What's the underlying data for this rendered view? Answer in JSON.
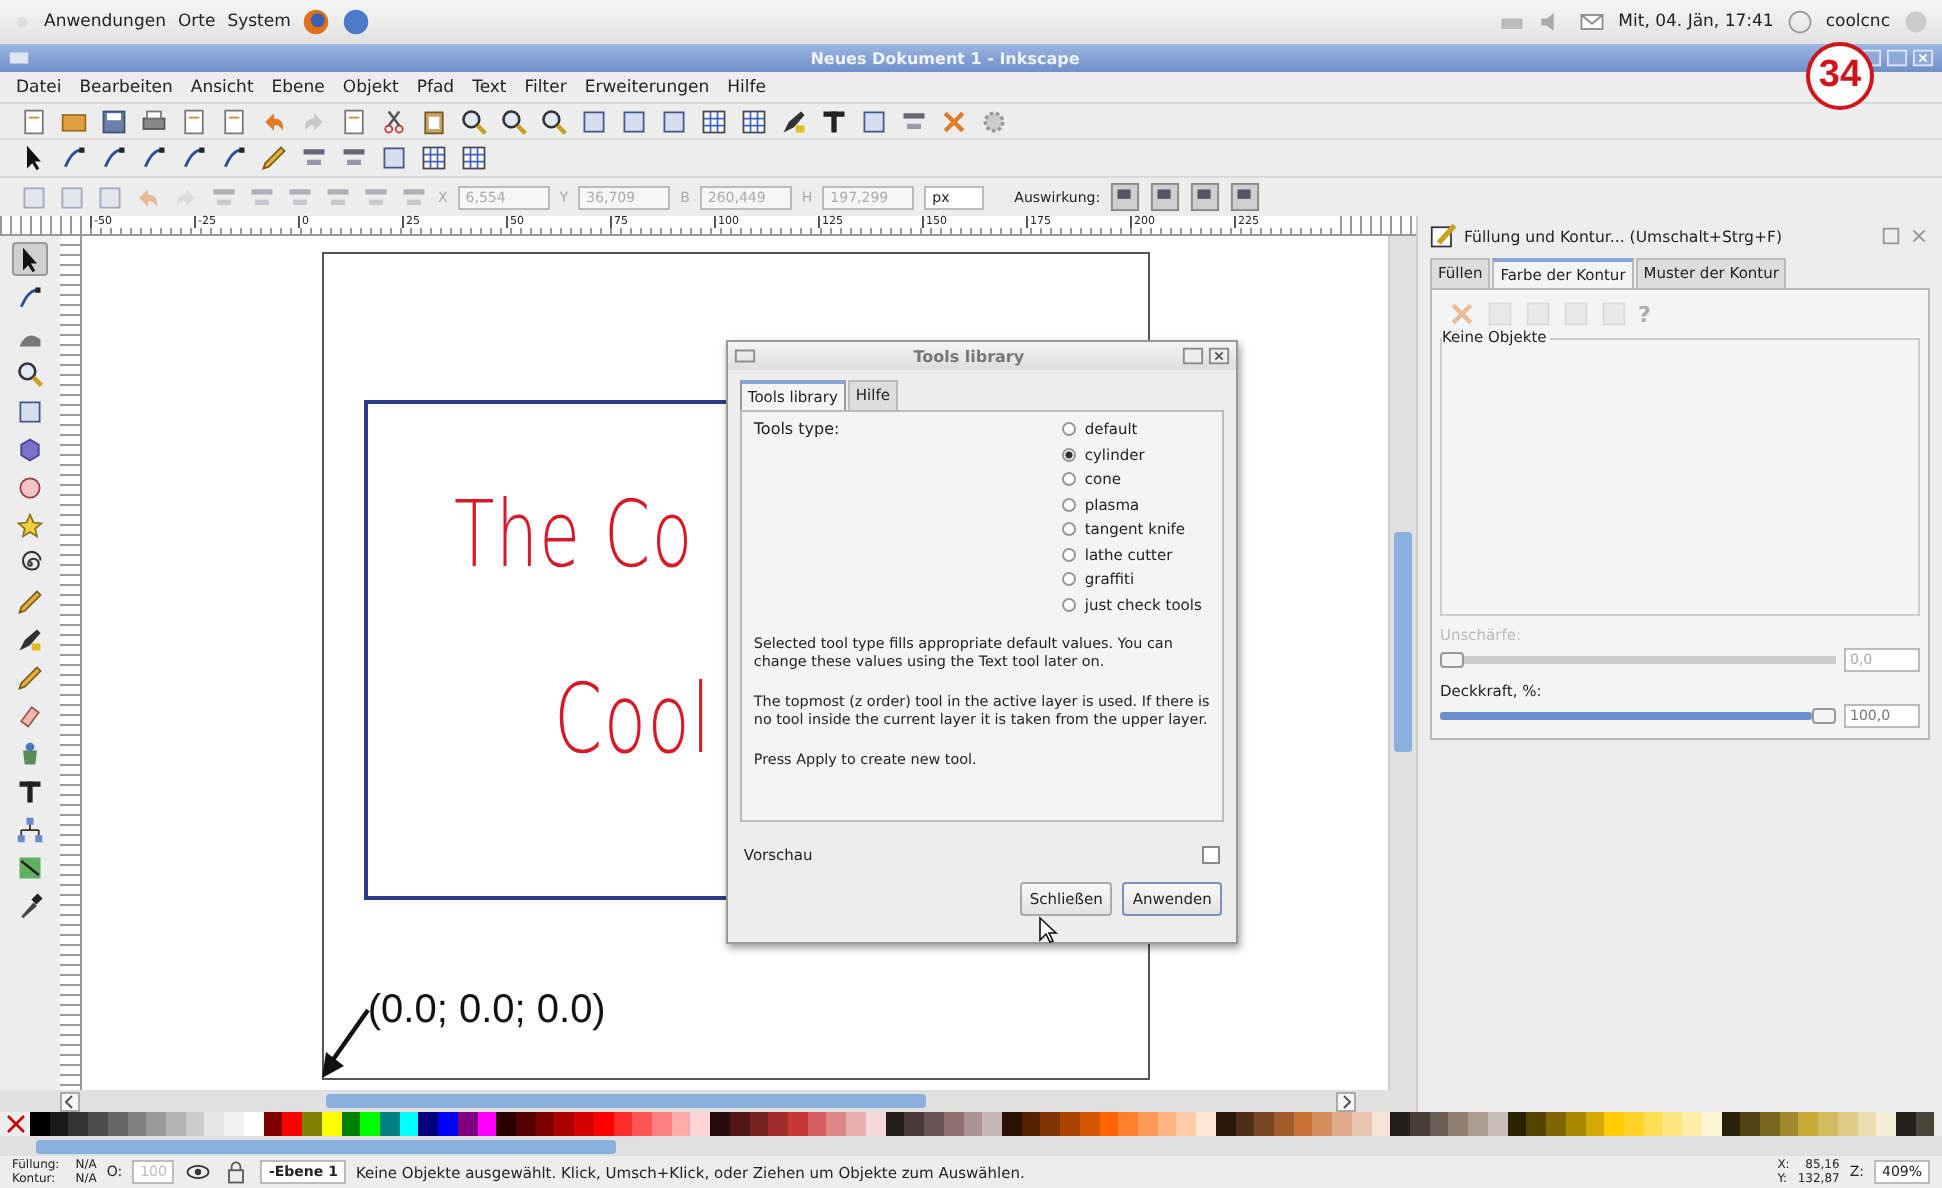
{
  "top_panel": {
    "menus": [
      "Anwendungen",
      "Orte",
      "System"
    ],
    "clock": "Mit, 04. Jän, 17:41",
    "user": "coolcnc"
  },
  "window": {
    "title": "Neues Dokument 1 - Inkscape"
  },
  "page_badge": "34",
  "menubar": [
    "Datei",
    "Bearbeiten",
    "Ansicht",
    "Ebene",
    "Objekt",
    "Pfad",
    "Text",
    "Filter",
    "Erweiterungen",
    "Hilfe"
  ],
  "toolbar_fields": [
    {
      "label": "X",
      "value": "6,554"
    },
    {
      "label": "Y",
      "value": "36,709"
    },
    {
      "label": "B",
      "value": "260,449"
    },
    {
      "label": "H",
      "value": "197,299"
    }
  ],
  "unit": "px",
  "effect_label": "Auswirkung:",
  "ruler_labels": [
    "-50",
    "-25",
    "0",
    "25",
    "50",
    "75",
    "100",
    "125",
    "150",
    "175",
    "200",
    "225"
  ],
  "toolbox": [
    {
      "selected": true
    },
    {
      "selected": false
    },
    {
      "selected": false
    },
    {
      "selected": false
    },
    {
      "selected": false
    },
    {
      "selected": false
    },
    {
      "selected": false
    },
    {
      "selected": false
    },
    {
      "selected": false
    },
    {
      "selected": false
    },
    {
      "selected": false
    },
    {
      "selected": false
    },
    {
      "selected": false
    },
    {
      "selected": false
    },
    {
      "selected": false
    },
    {
      "selected": false
    },
    {
      "selected": false
    },
    {
      "selected": false
    }
  ],
  "canvas": {
    "title_lines": [
      "The Co",
      "Cool"
    ],
    "coordinate_label": "(0.0; 0.0; 0.0)"
  },
  "dialog": {
    "title": "Tools library",
    "tabs": [
      {
        "label": "Tools library",
        "selected": true
      },
      {
        "label": "Hilfe",
        "selected": false
      }
    ],
    "type_label": "Tools type:",
    "options": [
      {
        "label": "default",
        "selected": false
      },
      {
        "label": "cylinder",
        "selected": true
      },
      {
        "label": "cone",
        "selected": false
      },
      {
        "label": "plasma",
        "selected": false
      },
      {
        "label": "tangent knife",
        "selected": false
      },
      {
        "label": "lathe cutter",
        "selected": false
      },
      {
        "label": "graffiti",
        "selected": false
      },
      {
        "label": "just check tools",
        "selected": false
      }
    ],
    "paragraphs": [
      "Selected tool type fills appropriate default values. You can change these values using the Text tool later on.",
      "The topmost (z order) tool in the active layer is used. If there is no tool inside the current layer it is taken from the upper layer.",
      "Press Apply to create new tool."
    ],
    "preview": {
      "label": "Vorschau",
      "checked": false
    },
    "buttons": [
      "Schließen",
      "Anwenden"
    ]
  },
  "fill_stroke": {
    "title": "Füllung und Kontur... (Umschalt+Strg+F)",
    "tabs": [
      {
        "label": "Füllen",
        "selected": false
      },
      {
        "label": "Farbe der Kontur",
        "selected": true
      },
      {
        "label": "Muster der Kontur",
        "selected": false
      }
    ],
    "unset_glyph": "?",
    "frame_label": "Keine Objekte",
    "sliders": [
      {
        "label": "Unschärfe:",
        "disabled": true,
        "level": 0,
        "value": "0,0"
      },
      {
        "label": "Deckkraft, %:",
        "disabled": false,
        "level": 1,
        "value": "100,0"
      }
    ]
  },
  "palette": [
    {
      "color": "#000000"
    },
    {
      "color": "#1a1a1a"
    },
    {
      "color": "#333333"
    },
    {
      "color": "#4d4d4d"
    },
    {
      "color": "#666666"
    },
    {
      "color": "#808080"
    },
    {
      "color": "#999999"
    },
    {
      "color": "#b3b3b3"
    },
    {
      "color": "#cccccc"
    },
    {
      "color": "#e6e6e6"
    },
    {
      "color": "#f2f2f2"
    },
    {
      "color": "#ffffff"
    },
    {
      "color": "#800000"
    },
    {
      "color": "#ff0000"
    },
    {
      "color": "#808000"
    },
    {
      "color": "#ffff00"
    },
    {
      "color": "#008000"
    },
    {
      "color": "#00ff00"
    },
    {
      "color": "#008080"
    },
    {
      "color": "#00ffff"
    },
    {
      "color": "#000080"
    },
    {
      "color": "#0000ff"
    },
    {
      "color": "#800080"
    },
    {
      "color": "#ff00ff"
    },
    {
      "color": "#2b0000"
    },
    {
      "color": "#550000"
    },
    {
      "color": "#800000"
    },
    {
      "color": "#aa0000"
    },
    {
      "color": "#d40000"
    },
    {
      "color": "#ff0000"
    },
    {
      "color": "#ff2a2a"
    },
    {
      "color": "#ff5555"
    },
    {
      "color": "#ff8080"
    },
    {
      "color": "#ffaaaa"
    },
    {
      "color": "#ffd5d5"
    },
    {
      "color": "#280b0b"
    },
    {
      "color": "#501616"
    },
    {
      "color": "#782121"
    },
    {
      "color": "#a02c2c"
    },
    {
      "color": "#c83737"
    },
    {
      "color": "#d35f5f"
    },
    {
      "color": "#de8787"
    },
    {
      "color": "#e9afaf"
    },
    {
      "color": "#f4d7d7"
    },
    {
      "color": "#241c1c"
    },
    {
      "color": "#483737"
    },
    {
      "color": "#6c5353"
    },
    {
      "color": "#916f6f"
    },
    {
      "color": "#ac9393"
    },
    {
      "color": "#c8b7b7"
    },
    {
      "color": "#2b1100"
    },
    {
      "color": "#552200"
    },
    {
      "color": "#803300"
    },
    {
      "color": "#aa4400"
    },
    {
      "color": "#d45500"
    },
    {
      "color": "#ff6600"
    },
    {
      "color": "#ff7f2a"
    },
    {
      "color": "#ff9955"
    },
    {
      "color": "#ffb380"
    },
    {
      "color": "#ffccaa"
    },
    {
      "color": "#ffe6d5"
    },
    {
      "color": "#28170b"
    },
    {
      "color": "#502d16"
    },
    {
      "color": "#784421"
    },
    {
      "color": "#a05a2c"
    },
    {
      "color": "#c87137"
    },
    {
      "color": "#d38d5f"
    },
    {
      "color": "#deaa87"
    },
    {
      "color": "#e9c6af"
    },
    {
      "color": "#f4e3d7"
    },
    {
      "color": "#241f1c"
    },
    {
      "color": "#483e37"
    },
    {
      "color": "#6c5d53"
    },
    {
      "color": "#917c6f"
    },
    {
      "color": "#ac9d93"
    },
    {
      "color": "#c8beb7"
    },
    {
      "color": "#2b2200"
    },
    {
      "color": "#554400"
    },
    {
      "color": "#806600"
    },
    {
      "color": "#aa8800"
    },
    {
      "color": "#d4aa00"
    },
    {
      "color": "#ffcc00"
    },
    {
      "color": "#ffd42a"
    },
    {
      "color": "#ffdd55"
    },
    {
      "color": "#ffe680"
    },
    {
      "color": "#ffeeaa"
    },
    {
      "color": "#fff6d5"
    },
    {
      "color": "#28220b"
    },
    {
      "color": "#504416"
    },
    {
      "color": "#786721"
    },
    {
      "color": "#a0892c"
    },
    {
      "color": "#c8ab37"
    },
    {
      "color": "#d3bc5f"
    },
    {
      "color": "#decd87"
    },
    {
      "color": "#e9ddaf"
    },
    {
      "color": "#f4eed7"
    },
    {
      "color": "#24221c"
    },
    {
      "color": "#484537"
    }
  ],
  "status_bar": {
    "fill_label": "Füllung:",
    "fill_value": "N/A",
    "stroke_label": "Kontur:",
    "stroke_value": "N/A",
    "opacity_label": "O:",
    "opacity_value": "100",
    "layer": "-Ebene 1",
    "message": "Keine Objekte ausgewählt. Klick, Umsch+Klick, oder Ziehen um Objekte zum Auswählen.",
    "x_label": "X:",
    "x_value": "85,16",
    "y_label": "Y:",
    "y_value": "132,87",
    "zoom_label": "Z:",
    "zoom_value": "409%"
  }
}
